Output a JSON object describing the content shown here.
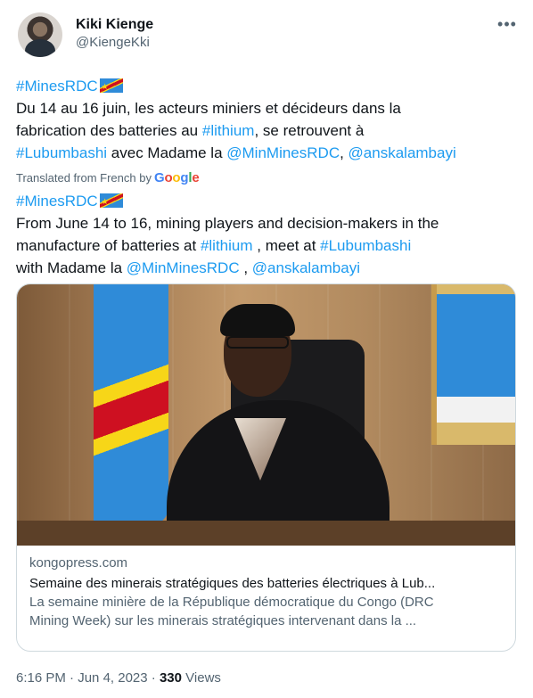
{
  "author": {
    "display_name": "Kiki Kienge",
    "handle": "@KiengeKki"
  },
  "tweet": {
    "hashtag1": "#MinesRDC",
    "line1": "Du 14 au 16 juin, les acteurs miniers et décideurs dans la",
    "line2_a": "fabrication des batteries au ",
    "hashtag_lithium": "#lithium",
    "line2_b": ", se retrouvent à",
    "hashtag_lubumbashi": "#Lubumbashi",
    "line3_a": " avec Madame la ",
    "mention_min": "@MinMinesRDC",
    "sep": ", ",
    "mention_ans": "@anskalambayi"
  },
  "translated_label": "Translated from French by",
  "google": [
    "G",
    "o",
    "o",
    "g",
    "l",
    "e"
  ],
  "translation": {
    "hashtag1": "#MinesRDC",
    "line1": "From June 14 to 16, mining players and decision-makers in the",
    "line2_a": "manufacture of batteries at ",
    "hashtag_lithium": "#lithium",
    "line2_b": " , meet at ",
    "hashtag_lubumbashi": "#Lubumbashi",
    "line3_a": "with Madame la ",
    "mention_min": "@MinMinesRDC",
    "sep": " , ",
    "mention_ans": "@anskalambayi"
  },
  "card": {
    "domain": "kongopress.com",
    "title": "Semaine des minerais stratégiques des batteries électriques à Lub...",
    "description_line1": "La semaine minière de la République démocratique du Congo (DRC",
    "description_line2": "Mining Week) sur les minerais stratégiques intervenant dans la ..."
  },
  "meta": {
    "time": "6:16 PM",
    "dot1": " · ",
    "date": "Jun 4, 2023",
    "dot2": " · ",
    "views_count": "330",
    "views_label": " Views"
  },
  "icons": {
    "more": "more-horizontal-icon",
    "flag": "drc-flag-emoji-icon"
  },
  "colors": {
    "link": "#1d9bf0",
    "secondary_text": "#536471",
    "primary_text": "#0f1419"
  }
}
